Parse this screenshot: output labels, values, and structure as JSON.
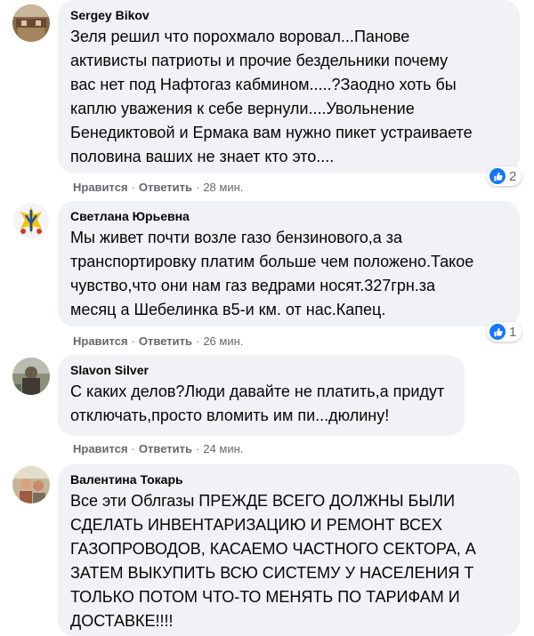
{
  "actions": {
    "like": "Нравится",
    "reply": "Ответить",
    "separator": "·"
  },
  "comments": [
    {
      "author": "Sergey Bikov",
      "text": "Зеля решил что порохмало воровал...Панове\nактивисты патриоты и прочие бездельники почему\nвас нет под Нафтогаз кабмином.....?Заодно хоть бы\nкаплю уважения к себе вернули....Увольнение\nБенедиктовой и Ермака вам нужно пикет устраиваете\nполовина ваших не знает кто это....",
      "time": "28 мин.",
      "reactions": "2"
    },
    {
      "author": "Светлана Юрьевна",
      "text": "Мы живет почти возле газо бензинового,а за\nтранспортировку платим больше чем положено.Такое\nчувство,что они нам газ ведрами носят.327грн.за\nмесяц а Шебелинка в5-и км. от нас.Капец.",
      "time": "26 мин.",
      "reactions": "1"
    },
    {
      "author": "Slavon Silver",
      "text": "С каких делов?Люди давайте не платить,а придут\nотключать,просто вломить им пи...дюлину!",
      "time": "24 мин."
    },
    {
      "author": "Валентина Токарь",
      "text": "Все эти Облгазы ПРЕЖДЕ ВСЕГО ДОЛЖНЫ БЫЛИ\nСДЕЛАТЬ ИНВЕНТАРИЗАЦИЮ И РЕМОНТ ВСЕХ\nГАЗОПРОВОДОВ, КАСАЕМО ЧАСТНОГО СЕКТОРА, А\nЗАТЕМ ВЫКУПИТЬ ВСЮ СИСТЕМУ У НАСЕЛЕНИЯ Т\nТОЛЬКО ПОТОМ ЧТО-ТО МЕНЯТЬ ПО ТАРИФАМ И\nДОСТАВКЕ!!!!"
    }
  ],
  "colors": {
    "bubble": "#f0f2f5",
    "meta": "#65676b",
    "like": "#1877f2"
  }
}
